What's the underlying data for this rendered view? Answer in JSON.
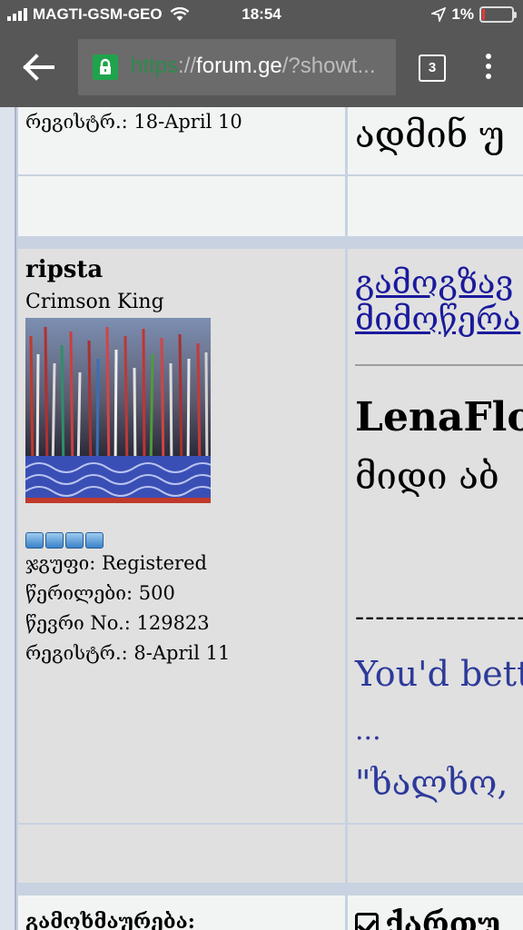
{
  "status_bar": {
    "carrier": "MAGTI-GSM-GEO",
    "time": "18:54",
    "battery": "1%"
  },
  "browser": {
    "url_scheme": "https",
    "url_sep": "://",
    "url_host": "forum.ge",
    "url_path": "/?showt...",
    "tab_count": "3"
  },
  "prev_post": {
    "registered": "რეგისტრ.: 18-April 10",
    "title_text": "ადმინ უ"
  },
  "post": {
    "username": "ripsta",
    "user_title": "Crimson King",
    "avatar_icon": "forest-painting-avatar",
    "group": "ჯგუფი: Registered",
    "posts": "წერილები: 500",
    "member_no": "წევრი No.: 129823",
    "registered": "რეგისტრ.: 8-April 11",
    "subject_line1": "გამოგზავ",
    "subject_line2": "მიმოწერა",
    "poster_name": "LenaFlow",
    "greeting": "მიდი აბ",
    "signature_dashes": "------------------",
    "signature_line1": "You'd bette",
    "signature_line2": "...",
    "signature_line3": "\"ხალხო,"
  },
  "next_post": {
    "rewards_label": "გამოხმაურება:",
    "rewards_text": "ქართუ"
  }
}
